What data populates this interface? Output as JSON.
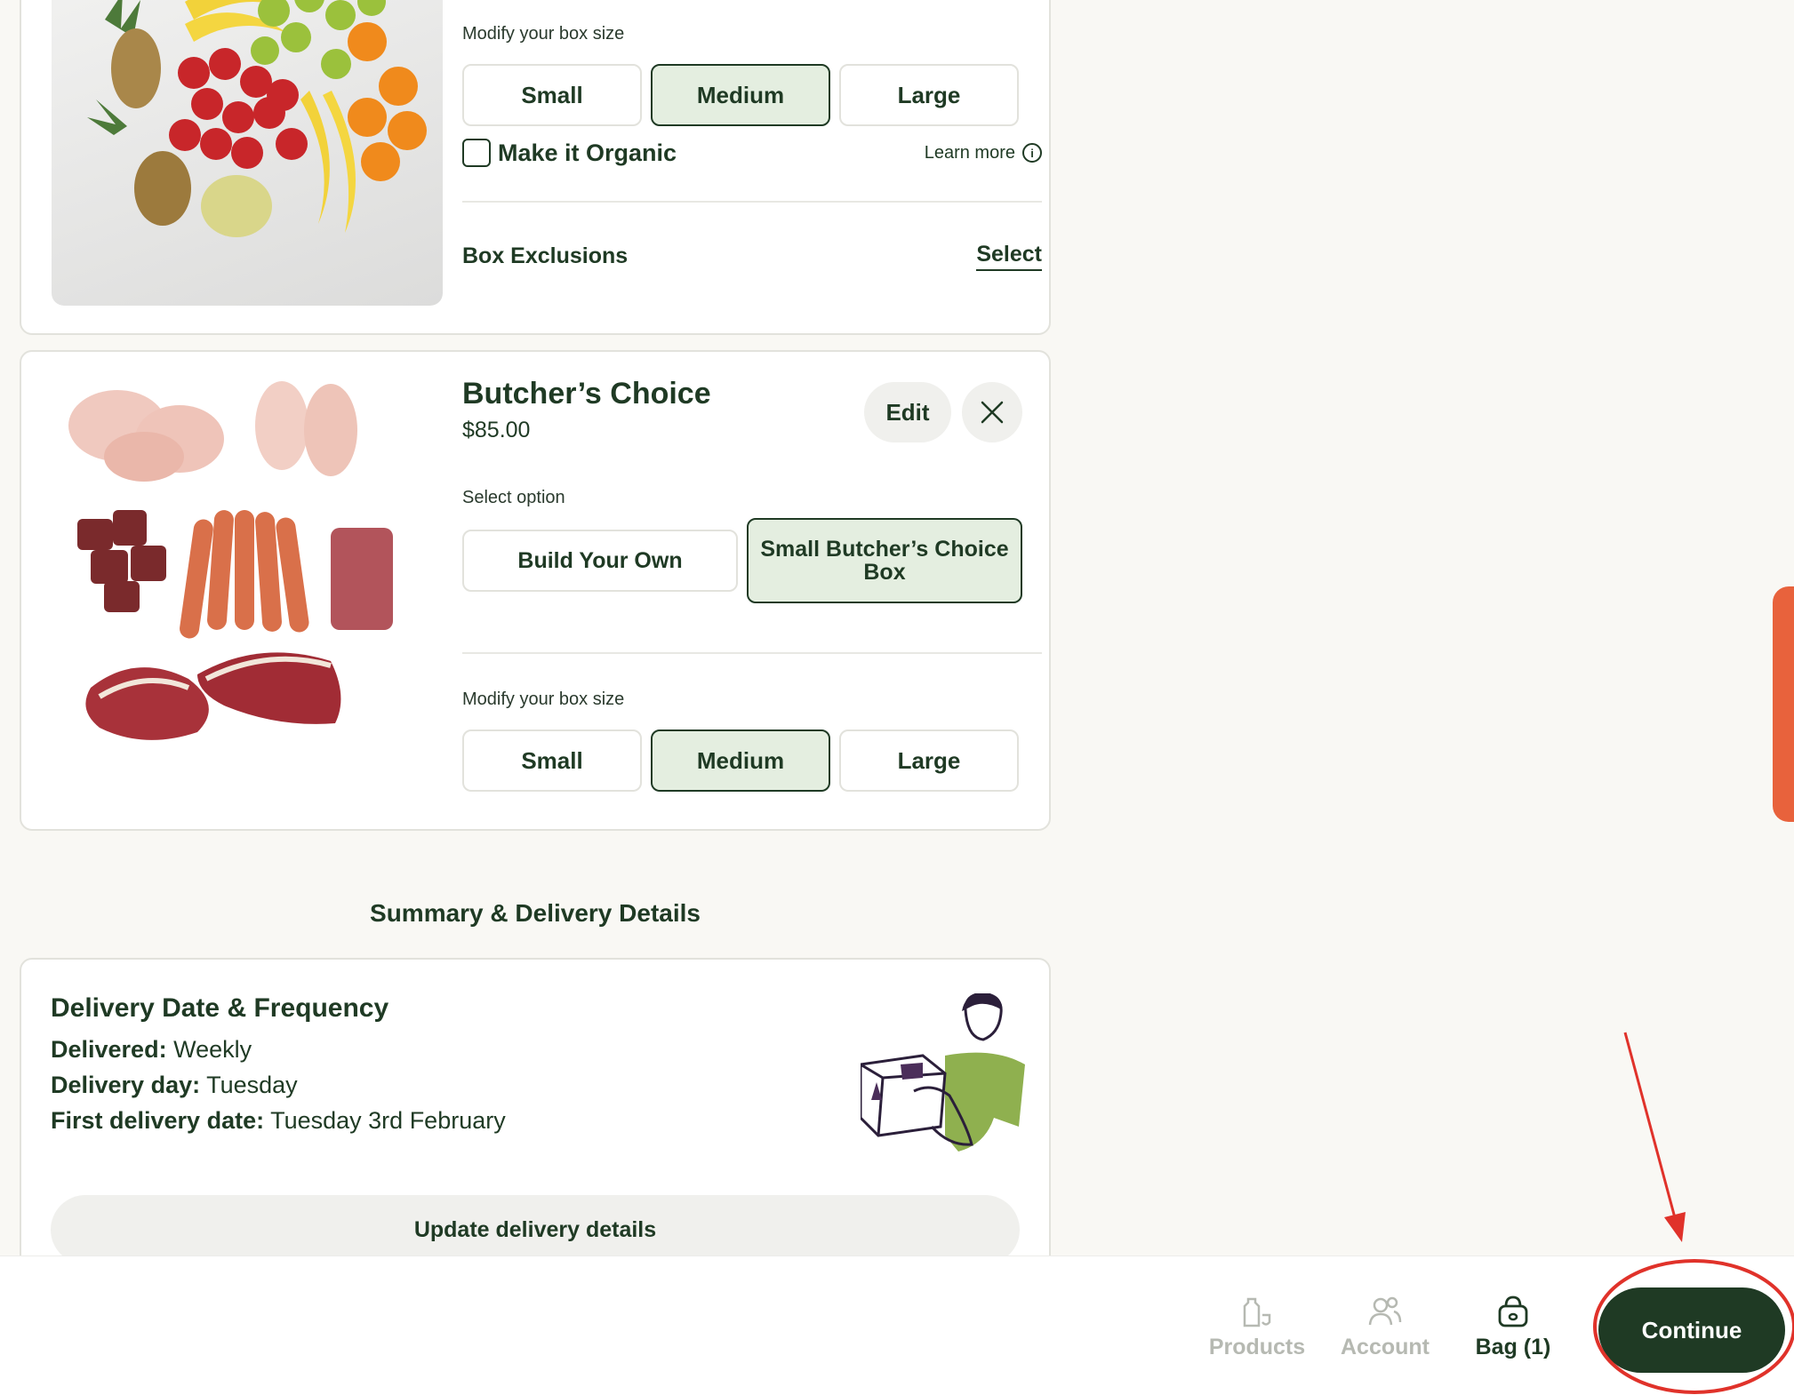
{
  "fruit_box": {
    "modify_size_label": "Modify your box size",
    "sizes": [
      "Small",
      "Medium",
      "Large"
    ],
    "selected_size": "Medium",
    "organic_label": "Make it Organic",
    "learn_more": "Learn more",
    "info_glyph": "i",
    "exclusions_label": "Box Exclusions",
    "exclusions_action": "Select"
  },
  "butcher_box": {
    "title": "Butcher’s Choice",
    "price": "$85.00",
    "edit_label": "Edit",
    "select_option_label": "Select option",
    "options": [
      "Build Your Own",
      "Small Butcher’s Choice Box"
    ],
    "selected_option": "Small Butcher’s Choice Box",
    "modify_size_label": "Modify your box size",
    "sizes": [
      "Small",
      "Medium",
      "Large"
    ],
    "selected_size": "Medium"
  },
  "summary": {
    "heading": "Summary & Delivery Details"
  },
  "delivery": {
    "title": "Delivery Date & Frequency",
    "delivered_label": "Delivered:",
    "delivered_value": "Weekly",
    "day_label": "Delivery day:",
    "day_value": "Tuesday",
    "first_label": "First delivery date:",
    "first_value": "Tuesday 3rd February",
    "update_button": "Update delivery details"
  },
  "bottom_nav": {
    "products": "Products",
    "account": "Account",
    "bag": "Bag (1)",
    "continue": "Continue"
  },
  "icons": {
    "close": "close-icon",
    "products": "products-icon",
    "account": "account-icon",
    "bag": "bag-icon"
  },
  "colors": {
    "brand_dark": "#1f3a24",
    "selected_fill": "#e4eee0",
    "side_tab": "#e8623c",
    "annotation_red": "#e0322a"
  }
}
